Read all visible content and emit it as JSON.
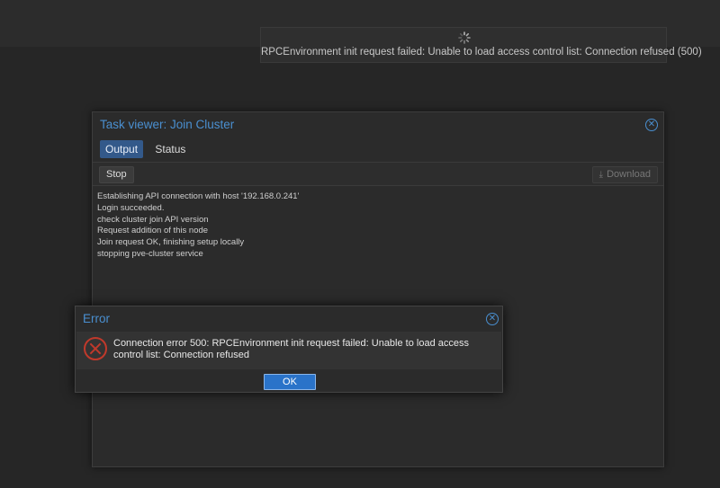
{
  "load_mask": {
    "message": "RPCEnvironment init request failed: Unable to load access control list: Connection refused (500)"
  },
  "task_viewer": {
    "title": "Task viewer: Join Cluster",
    "tabs": [
      {
        "label": "Output",
        "active": true
      },
      {
        "label": "Status",
        "active": false
      }
    ],
    "toolbar": {
      "stop_label": "Stop",
      "download_label": "Download"
    },
    "log_lines": [
      "Establishing API connection with host '192.168.0.241'",
      "Login succeeded.",
      "check cluster join API version",
      "Request addition of this node",
      "Join request OK, finishing setup locally",
      "stopping pve-cluster service"
    ]
  },
  "error_dialog": {
    "title": "Error",
    "message": "Connection error 500: RPCEnvironment init request failed: Unable to load access control list: Connection refused",
    "ok_label": "OK"
  },
  "colors": {
    "accent": "#4a8fd0",
    "error": "#c0392b",
    "primary_button": "#2a73c9"
  }
}
